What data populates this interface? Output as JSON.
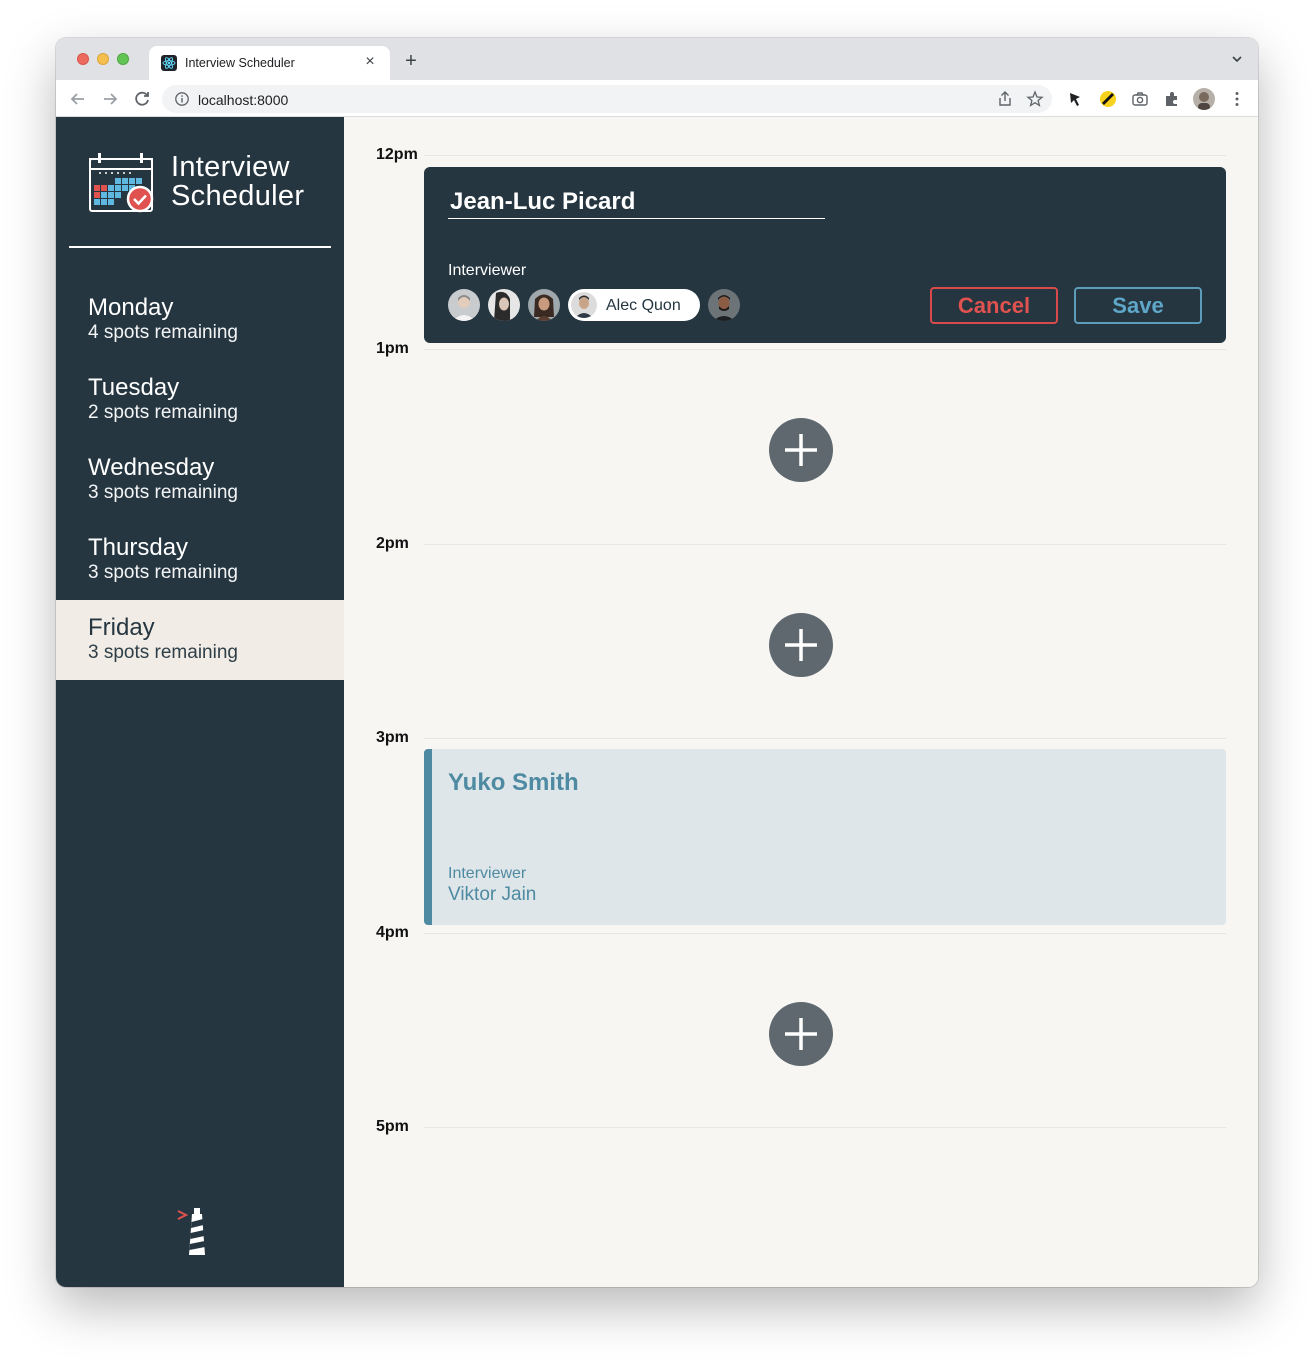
{
  "browser": {
    "tab_title": "Interview Scheduler",
    "url": "localhost:8000",
    "new_tab_symbol": "+",
    "close_tab_symbol": "×"
  },
  "sidebar": {
    "logo_line1": "Interview",
    "logo_line2": "Scheduler",
    "days": [
      {
        "name": "Monday",
        "spots": "4 spots remaining"
      },
      {
        "name": "Tuesday",
        "spots": "2 spots remaining"
      },
      {
        "name": "Wednesday",
        "spots": "3 spots remaining"
      },
      {
        "name": "Thursday",
        "spots": "3 spots remaining"
      },
      {
        "name": "Friday",
        "spots": "3 spots remaining",
        "selected": true
      }
    ]
  },
  "schedule": {
    "times": [
      "12pm",
      "1pm",
      "2pm",
      "3pm",
      "4pm",
      "5pm"
    ],
    "form": {
      "student_name": "Jean-Luc Picard",
      "interviewer_label": "Interviewer",
      "selected_interviewer": "Alec Quon",
      "cancel_label": "Cancel",
      "save_label": "Save"
    },
    "booked": {
      "student": "Yuko Smith",
      "interviewer_label": "Interviewer",
      "interviewer": "Viktor Jain"
    }
  },
  "colors": {
    "sidebar_bg": "#253640",
    "selected_day_bg": "#f1ece6",
    "accent_blue": "#4e8aa2",
    "cancel_red": "#e0524f",
    "add_button": "#5f686e"
  }
}
